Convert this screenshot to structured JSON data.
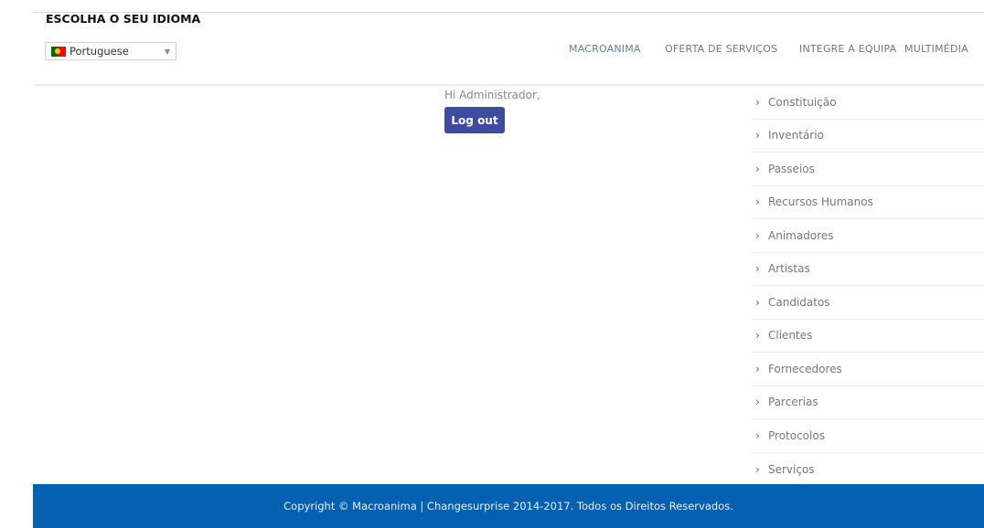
{
  "language": {
    "title": "ESCOLHA O SEU IDIOMA",
    "selected": "Portuguese",
    "flag_colors": [
      "#006600",
      "#ff0000",
      "#ffcc00"
    ]
  },
  "nav": {
    "items": [
      {
        "label": "MACROANIMA",
        "active": true
      },
      {
        "label": "OFERTA DE SERVIÇOS",
        "active": false
      },
      {
        "label": "INTEGRE A EQUIPA",
        "active": false
      },
      {
        "label": "MULTIMÉDIA",
        "active": false
      }
    ]
  },
  "main": {
    "greeting": "Hi Administrador,",
    "logout_label": "Log out"
  },
  "sidebar": {
    "items": [
      "Constituição",
      "Inventário",
      "Passeios",
      "Recursos Humanos",
      "Animadores",
      "Artistas",
      "Candidatos",
      "Clientes",
      "Fornecedores",
      "Parcerias",
      "Protocolos",
      "Serviços"
    ]
  },
  "footer": {
    "text": "Copyright © Macroanima | Changesurprise 2014-2017. Todos os Direitos Reservados."
  },
  "colors": {
    "accent": "#3f4aa1",
    "footer_bg": "#0460b0",
    "nav_active": "#5c7fa3"
  },
  "icons": {
    "sidebar_bullet": "chevron-right-icon",
    "select_caret": "chevron-down-icon"
  }
}
